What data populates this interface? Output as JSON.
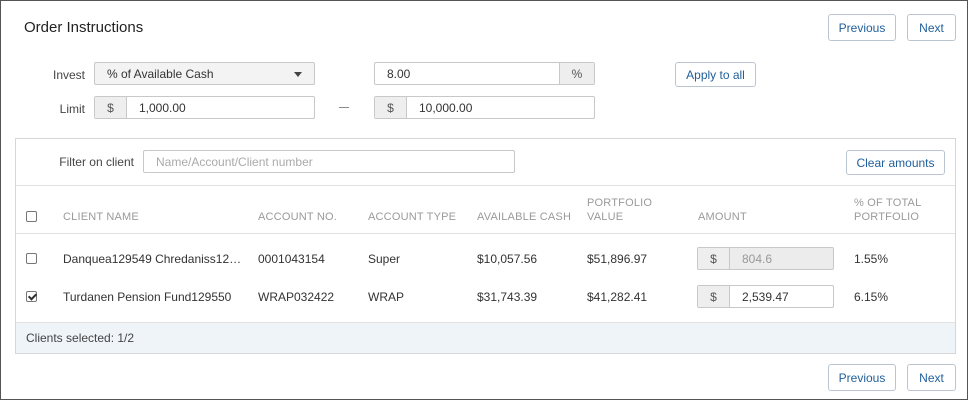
{
  "title": "Order Instructions",
  "nav": {
    "previous_label": "Previous",
    "next_label": "Next"
  },
  "invest": {
    "label": "Invest",
    "selected": "% of Available Cash",
    "value": "8.00",
    "unit": "%",
    "apply_label": "Apply to all"
  },
  "limit": {
    "label": "Limit",
    "currency": "$",
    "min": "1,000.00",
    "max": "10,000.00"
  },
  "filter": {
    "label": "Filter on client",
    "placeholder": "Name/Account/Client number",
    "clear_label": "Clear amounts"
  },
  "table": {
    "columns": {
      "client_name": "CLIENT NAME",
      "account_no": "ACCOUNT NO.",
      "account_type": "ACCOUNT TYPE",
      "available_cash": "AVAILABLE CASH",
      "portfolio_value_line1": "PORTFOLIO",
      "portfolio_value_line2": "VALUE",
      "amount": "AMOUNT",
      "pct_total_line1": "% OF TOTAL",
      "pct_total_line2": "PORTFOLIO"
    },
    "rows": [
      {
        "checked": false,
        "client_name": "Danquea129549 Chredaniss12…",
        "account_no": "0001043154",
        "account_type": "Super",
        "available_cash": "$10,057.56",
        "portfolio_value": "$51,896.97",
        "currency": "$",
        "amount": "804.6",
        "amount_disabled": true,
        "pct_total": "1.55%"
      },
      {
        "checked": true,
        "client_name": "Turdanen Pension Fund129550",
        "account_no": "WRAP032422",
        "account_type": "WRAP",
        "available_cash": "$31,743.39",
        "portfolio_value": "$41,282.41",
        "currency": "$",
        "amount": "2,539.47",
        "amount_disabled": false,
        "pct_total": "6.15%"
      }
    ]
  },
  "footer": {
    "clients_selected": "Clients selected: 1/2"
  },
  "colors": {
    "link_blue": "#1f5f9b",
    "footer_bg": "#eef4f8",
    "border": "#c8c8c8"
  }
}
